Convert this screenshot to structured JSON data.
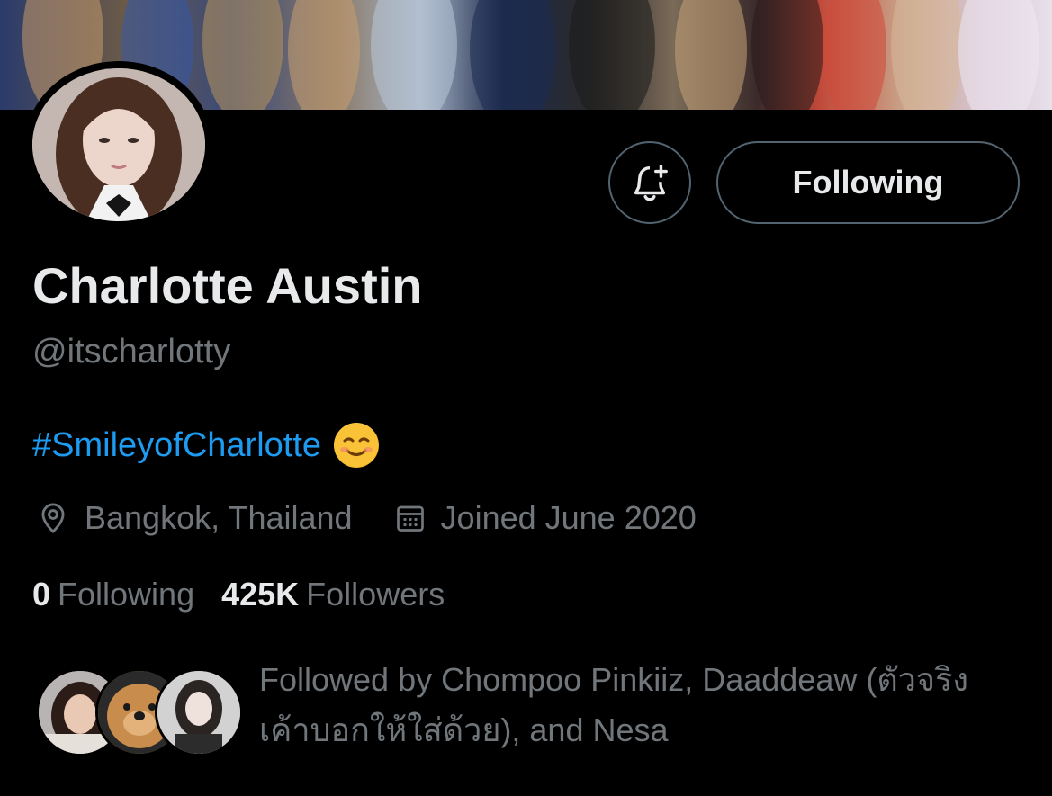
{
  "profile": {
    "name": "Charlotte Austin",
    "handle": "@itscharlotty",
    "bio_hashtag": "#SmileyofCharlotte",
    "location": "Bangkok, Thailand",
    "joined": "Joined June 2020",
    "following_count": "0",
    "following_label": "Following",
    "followers_count": "425K",
    "followers_label": "Followers",
    "followed_by": "Followed by Chompoo Pinkiiz, Daaddeaw (ตัวจริงเค้าบอกให้ใส่ด้วย), and Nesa"
  },
  "actions": {
    "follow_state_label": "Following",
    "notify_icon": "bell-plus-icon"
  },
  "colors": {
    "background": "#000000",
    "text_primary": "#e7e9ea",
    "text_secondary": "#71767b",
    "link": "#1d9bf0",
    "button_border": "#536471"
  }
}
